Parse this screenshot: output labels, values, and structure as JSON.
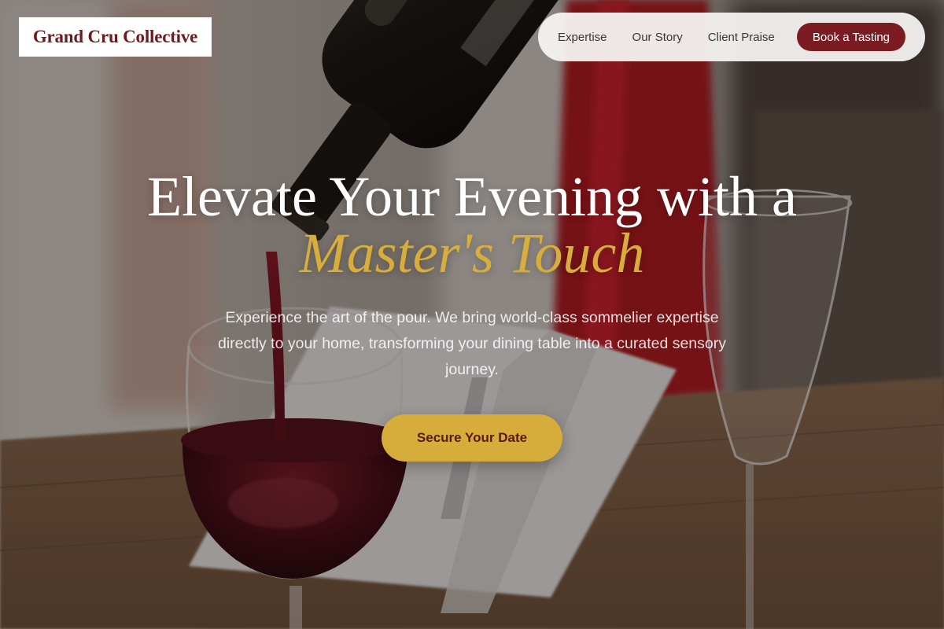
{
  "brand": {
    "logo_text": "Grand Cru Collective",
    "logo_color": "#6e1a1f"
  },
  "nav": {
    "links": [
      "Expertise",
      "Our Story",
      "Client Praise"
    ],
    "cta_label": "Book a Tasting",
    "cta_color": "#7a1c22"
  },
  "hero": {
    "headline_line1": "Elevate Your Evening with a",
    "headline_accent": "Master's Touch",
    "accent_color": "#d8ad3c",
    "subtitle": "Experience the art of the pour. We bring world-class sommelier expertise directly to your home, transforming your dining table into a curated sensory journey.",
    "cta_label": "Secure Your Date",
    "cta_color": "#d6ad3a",
    "background_image": "wine-pour-photo"
  }
}
